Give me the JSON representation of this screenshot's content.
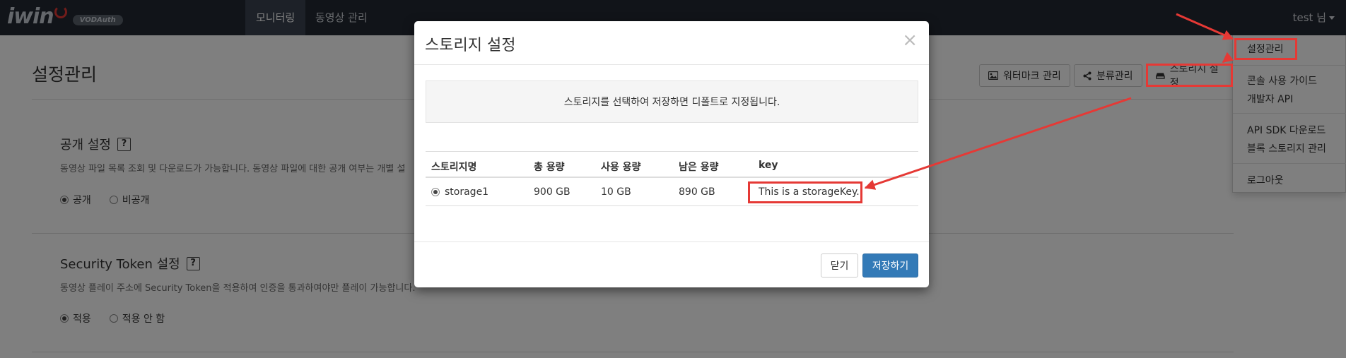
{
  "navbar": {
    "logo_text": "iwin",
    "logo_badge": "VODAuth",
    "menu": [
      {
        "label": "모니터링",
        "active": true
      },
      {
        "label": "동영상 관리",
        "active": false
      }
    ],
    "user_label": "test 님"
  },
  "page": {
    "title": "설정관리",
    "toolbar": {
      "watermark_label": "워터마크 관리",
      "category_label": "분류관리",
      "storage_label": "스토리지 설정"
    },
    "public_section": {
      "title": "공개 설정",
      "help": "?",
      "description": "동영상 파일 목록 조회 및 다운로드가 가능합니다. 동영상 파일에 대한 공개 여부는 개별 설",
      "options": [
        {
          "label": "공개",
          "checked": true
        },
        {
          "label": "비공개",
          "checked": false
        }
      ]
    },
    "token_section": {
      "title": "Security Token 설정",
      "help": "?",
      "description": "동영상 플레이 주소에 Security Token을 적용하여 인증을 통과하여야만 플레이 가능합니다.",
      "options": [
        {
          "label": "적용",
          "checked": true
        },
        {
          "label": "적용 안 함",
          "checked": false
        }
      ]
    }
  },
  "user_dropdown": {
    "groups": [
      [
        "설정관리"
      ],
      [
        "콘솔 사용 가이드",
        "개발자 API"
      ],
      [
        "API SDK 다운로드",
        "블록 스토리지 관리"
      ],
      [
        "로그아웃"
      ]
    ]
  },
  "modal": {
    "title": "스토리지 설정",
    "close_symbol": "×",
    "notice": "스토리지를 선택하여 저장하면 디폴트로 지정됩니다.",
    "table": {
      "headers": [
        "스토리지명",
        "총 용량",
        "사용 용량",
        "남은 용량",
        "key"
      ],
      "rows": [
        {
          "name": "storage1",
          "total": "900 GB",
          "used": "10 GB",
          "remaining": "890 GB",
          "key": "This is a storageKey.",
          "selected": true
        }
      ]
    },
    "close_button": "닫기",
    "save_button": "저장하기"
  },
  "colors": {
    "navbar_bg": "#222933",
    "primary": "#337ab7",
    "annotation": "#e53935"
  },
  "icons": [
    "image-icon",
    "share-icon",
    "hdd-icon",
    "close-icon",
    "question-icon",
    "caret-down-icon",
    "power-icon"
  ]
}
